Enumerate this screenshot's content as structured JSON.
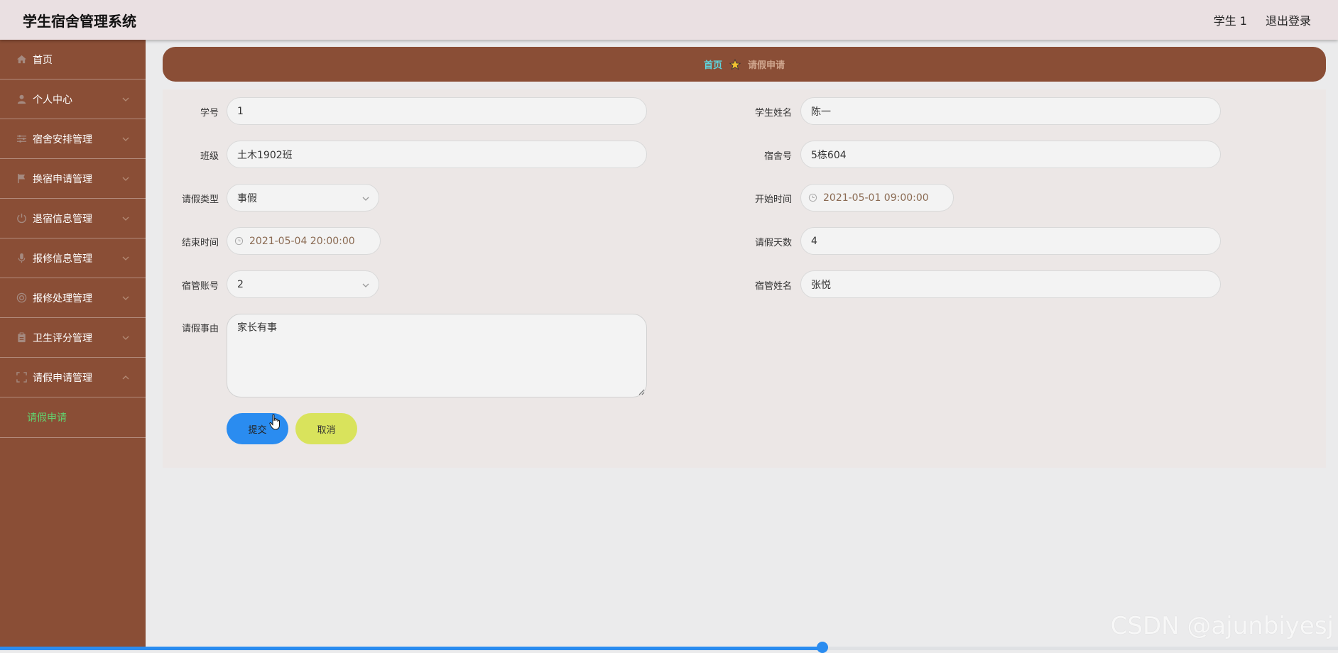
{
  "header": {
    "app_title": "学生宿舍管理系统",
    "user_label": "学生 1",
    "logout_label": "退出登录"
  },
  "sidebar": {
    "items": [
      {
        "label": "首页",
        "icon": "home-icon"
      },
      {
        "label": "个人中心",
        "icon": "user-icon"
      },
      {
        "label": "宿舍安排管理",
        "icon": "sliders-icon"
      },
      {
        "label": "换宿申请管理",
        "icon": "flag-icon"
      },
      {
        "label": "退宿信息管理",
        "icon": "power-icon"
      },
      {
        "label": "报修信息管理",
        "icon": "microphone-icon"
      },
      {
        "label": "报修处理管理",
        "icon": "target-icon"
      },
      {
        "label": "卫生评分管理",
        "icon": "clipboard-icon"
      },
      {
        "label": "请假申请管理",
        "icon": "fullscreen-icon"
      }
    ],
    "submenu": {
      "label": "请假申请"
    }
  },
  "breadcrumb": {
    "home": "首页",
    "current": "请假申请"
  },
  "form": {
    "student_no": {
      "label": "学号",
      "value": "1"
    },
    "student_name": {
      "label": "学生姓名",
      "value": "陈一"
    },
    "class": {
      "label": "班级",
      "value": "土木1902班"
    },
    "dorm_no": {
      "label": "宿舍号",
      "value": "5栋604"
    },
    "leave_type": {
      "label": "请假类型",
      "value": "事假"
    },
    "start_time": {
      "label": "开始时间",
      "value": "2021-05-01 09:00:00"
    },
    "end_time": {
      "label": "结束时间",
      "value": "2021-05-04 20:00:00"
    },
    "leave_days": {
      "label": "请假天数",
      "value": "4"
    },
    "manager_account": {
      "label": "宿管账号",
      "value": "2"
    },
    "manager_name": {
      "label": "宿管姓名",
      "value": "张悦"
    },
    "reason": {
      "label": "请假事由",
      "value": "家长有事"
    },
    "submit_label": "提交",
    "cancel_label": "取消"
  },
  "watermark": "CSDN @ajunbiyesj",
  "colors": {
    "sidebar_bg": "#8a4e36",
    "header_bg": "#eae0e2",
    "accent_blue": "#2a8cf0",
    "cancel_yellow": "#d9e35c",
    "active_green": "#62d26f",
    "crumb_home": "#5ed6df"
  }
}
